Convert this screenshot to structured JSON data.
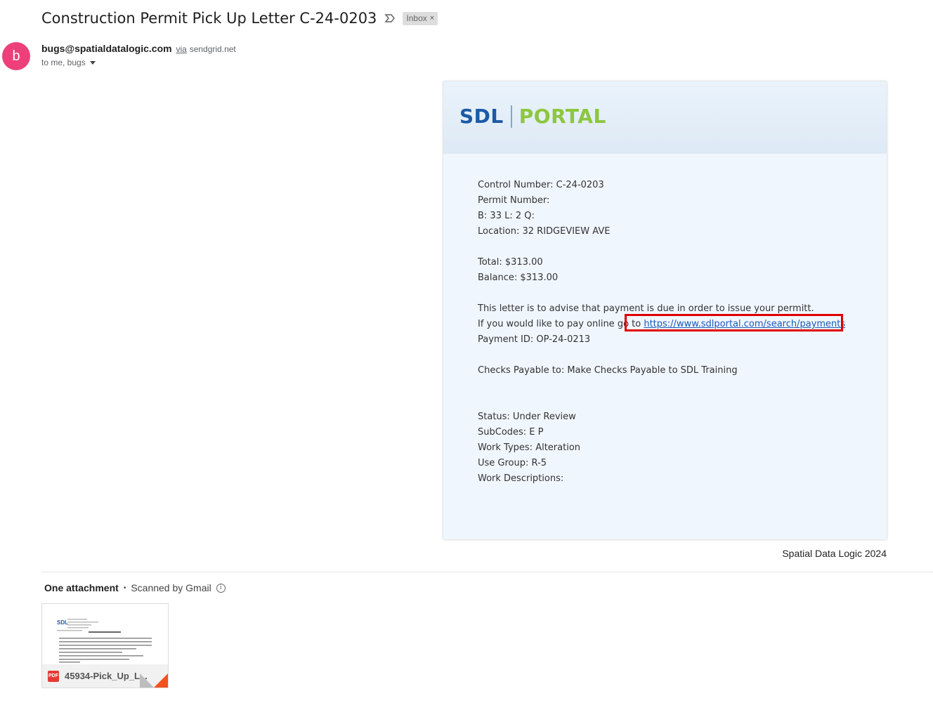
{
  "email": {
    "subject": "Construction Permit Pick Up Letter C-24-0203",
    "label": "Inbox",
    "label_remove": "×",
    "avatar_letter": "b",
    "sender_email": "bugs@spatialdatalogic.com",
    "via": "via",
    "via_domain": "sendgrid.net",
    "recipients": "to me, bugs"
  },
  "card": {
    "logo_left": "SDL",
    "logo_right": "PORTAL",
    "lines": {
      "control_number": "Control Number: C-24-0203",
      "permit_number": "Permit Number:",
      "block_lot": "B: 33 L: 2 Q:",
      "location": "Location: 32 RIDGEVIEW AVE",
      "total": "Total: $313.00",
      "balance": "Balance: $313.00",
      "advise": "This letter is to advise that payment is due in order to issue your permitt.",
      "pay_online_prefix": "If you would like to pay online go to ",
      "pay_link": "https://www.sdlportal.com/search/payments",
      "payment_id": "Payment ID: OP-24-0213",
      "checks": "Checks Payable to: Make Checks Payable to SDL Training",
      "status": "Status: Under Review",
      "subcodes": "SubCodes: E P",
      "work_types": "Work Types: Alteration",
      "use_group": "Use Group: R-5",
      "work_descriptions": "Work Descriptions:"
    }
  },
  "footer": {
    "copyright": "Spatial Data Logic 2024"
  },
  "attachments": {
    "header_title": "One attachment",
    "separator": "•",
    "scanned": "Scanned by Gmail",
    "file_type": "PDF",
    "file_name": "45934-Pick_Up_L..."
  },
  "colors": {
    "avatar": "#ec407a",
    "logo_sdl": "#1b5aa6",
    "logo_portal": "#8dc63f",
    "link": "#1a5bb8",
    "highlight": "#e00000"
  }
}
